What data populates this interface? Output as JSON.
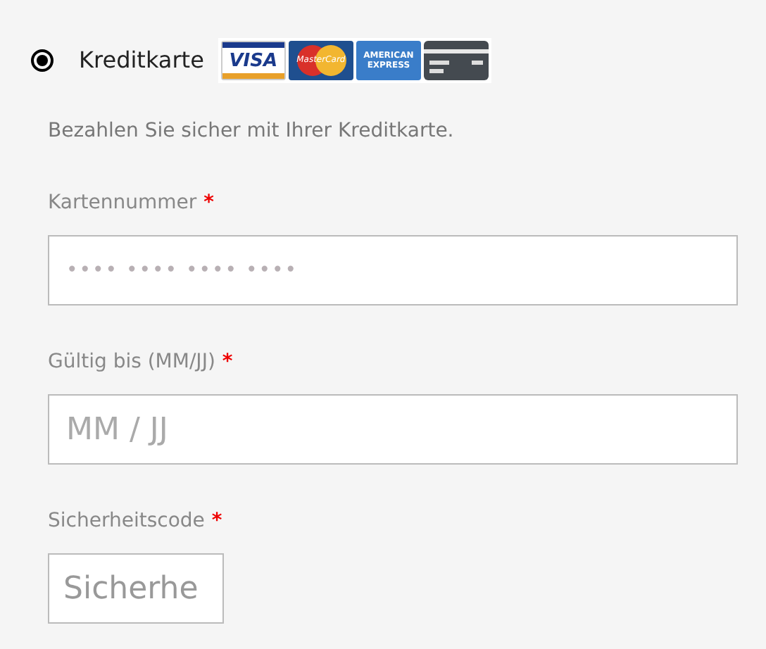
{
  "payment_method": {
    "label": "Kreditkarte",
    "selected": true,
    "cards": [
      {
        "kind": "visa",
        "label": "VISA"
      },
      {
        "kind": "mastercard",
        "label": "MasterCard"
      },
      {
        "kind": "amex",
        "label": "AMERICAN EXPRESS"
      },
      {
        "kind": "generic"
      }
    ]
  },
  "description": "Bezahlen Sie sicher mit Ihrer Kreditkarte.",
  "fields": [
    {
      "label": "Kartennummer",
      "required_mark": "*",
      "placeholder": "•••• •••• •••• ••••",
      "kind": "dots"
    },
    {
      "label": "Gültig bis (MM/JJ)",
      "required_mark": "*",
      "placeholder": "MM / JJ",
      "kind": "wide"
    },
    {
      "label": "Sicherheitscode",
      "required_mark": "*",
      "placeholder": "Sicherhe",
      "kind": "short"
    }
  ]
}
